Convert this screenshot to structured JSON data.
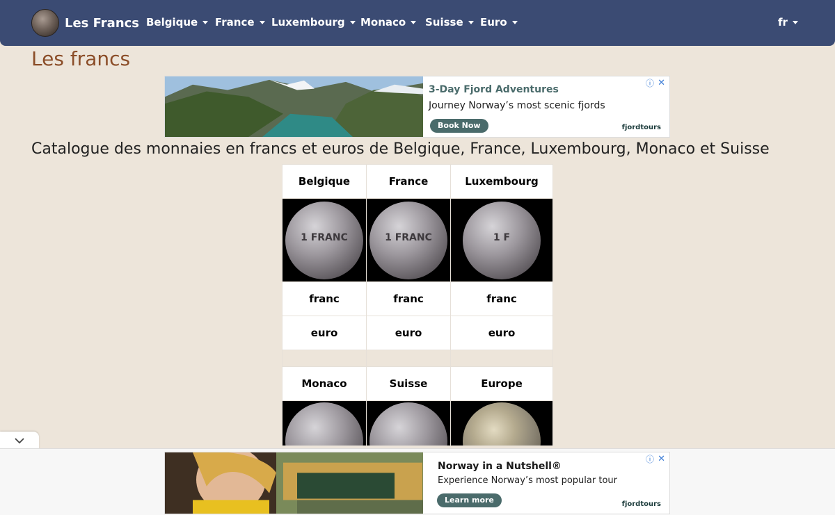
{
  "brand": {
    "name": "Les Francs"
  },
  "nav": {
    "items": [
      {
        "label": "Belgique"
      },
      {
        "label": "France"
      },
      {
        "label": "Luxembourg"
      },
      {
        "label": "Monaco"
      },
      {
        "label": "Suisse"
      },
      {
        "label": "Euro"
      }
    ],
    "language": "fr"
  },
  "page": {
    "title": "Les francs",
    "subtitle": "Catalogue des monnaies en francs et euros de Belgique, France, Luxembourg, Monaco et Suisse"
  },
  "ad_top": {
    "headline": "3-Day Fjord Adventures",
    "text": "Journey Norway’s most scenic fjords",
    "cta": "Book Now",
    "advertiser": "fjordtours"
  },
  "ad_bottom": {
    "headline": "Norway in a Nutshell®",
    "text": "Experience Norway’s most popular tour",
    "cta": "Learn more",
    "advertiser": "fjordtours"
  },
  "catalogue": {
    "row1_headers": [
      "Belgique",
      "France",
      "Luxembourg"
    ],
    "row1_franc": [
      "franc",
      "franc",
      "franc"
    ],
    "row1_euro": [
      "euro",
      "euro",
      "euro"
    ],
    "row2_headers": [
      "Monaco",
      "Suisse",
      "Europe"
    ],
    "coin_labels": [
      "1 FRANC",
      "1 FRANC",
      "1 F"
    ]
  },
  "colors": {
    "navbar": "#3b4b73",
    "background": "#ede5da",
    "title": "#8b4d28",
    "ad_cta": "#4a6b6b"
  }
}
